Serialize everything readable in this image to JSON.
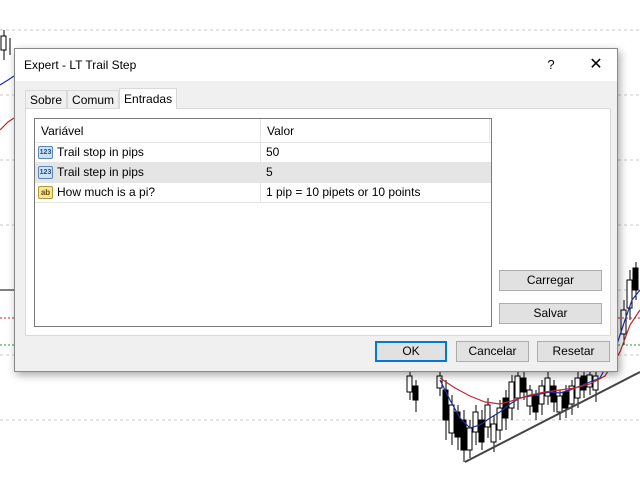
{
  "dialog": {
    "title": "Expert - LT Trail Step",
    "help_label": "?",
    "close_label": "✕"
  },
  "tabs": [
    {
      "label": "Sobre",
      "active": false
    },
    {
      "label": "Comum",
      "active": false
    },
    {
      "label": "Entradas",
      "active": true
    }
  ],
  "grid": {
    "columns": [
      "Variável",
      "Valor"
    ],
    "rows": [
      {
        "icon": "123",
        "icon_name": "integer-type-icon",
        "name": "Trail stop in pips",
        "value": "50",
        "selected": false
      },
      {
        "icon": "123",
        "icon_name": "integer-type-icon",
        "name": "Trail step in pips",
        "value": "5",
        "selected": true
      },
      {
        "icon": "ab",
        "icon_name": "string-type-icon",
        "name": "How much is a pi?",
        "value": "1 pip = 10 pipets or 10 points",
        "selected": false
      }
    ]
  },
  "side_buttons": {
    "load": "Carregar",
    "save": "Salvar"
  },
  "footer_buttons": {
    "ok": "OK",
    "cancel": "Cancelar",
    "reset": "Resetar"
  }
}
